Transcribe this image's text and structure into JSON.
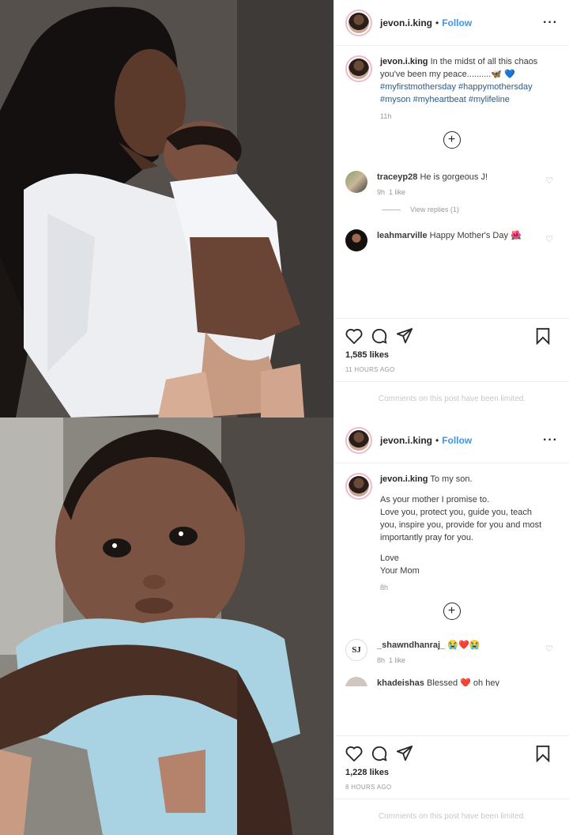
{
  "post1": {
    "username": "jevon.i.king",
    "follow_label": "Follow",
    "separator": "•",
    "more_icon": "more-horizontal-icon",
    "caption": {
      "username": "jevon.i.king",
      "text": "In the midst of all this chaos you've been my peace..........🦋 💙",
      "hashtags": "#myfirstmothersday #happymothersday #myson #myheartbeat #mylifeline",
      "time": "11h"
    },
    "add_comment_icon": "plus-circle-icon",
    "comments": [
      {
        "username": "traceyp28",
        "text": "He is gorgeous J!",
        "time": "9h",
        "likes": "1 like"
      },
      {
        "username": "leahmarville",
        "text": "Happy Mother's Day 🌺"
      }
    ],
    "view_replies": "View replies (1)",
    "likes": "1,585 likes",
    "posted": "11 HOURS AGO",
    "limited_notice": "Comments on this post have been limited."
  },
  "post2": {
    "username": "jevon.i.king",
    "follow_label": "Follow",
    "separator": "•",
    "more_icon": "more-horizontal-icon",
    "caption": {
      "username": "jevon.i.king",
      "line1": "To my son.",
      "line2": "As your mother I promise to.",
      "line3": "Love you, protect you, guide you, teach you, inspire you, provide for you and most importantly pray for you.",
      "line4": "Love",
      "line5": "Your Mom",
      "time": "8h"
    },
    "add_comment_icon": "plus-circle-icon",
    "comments": [
      {
        "username": "_shawndhanraj_",
        "text": "😭❤️😭",
        "time": "8h",
        "likes": "1 like"
      },
      {
        "username": "khadeishas",
        "text": "Blessed ❤️ oh hey"
      }
    ],
    "likes": "1,228 likes",
    "posted": "8 HOURS AGO",
    "limited_notice": "Comments on this post have been limited."
  },
  "colors": {
    "follow": "#3897f0",
    "hashtag": "#2b5b8a",
    "muted": "#999999",
    "text": "#262626"
  }
}
